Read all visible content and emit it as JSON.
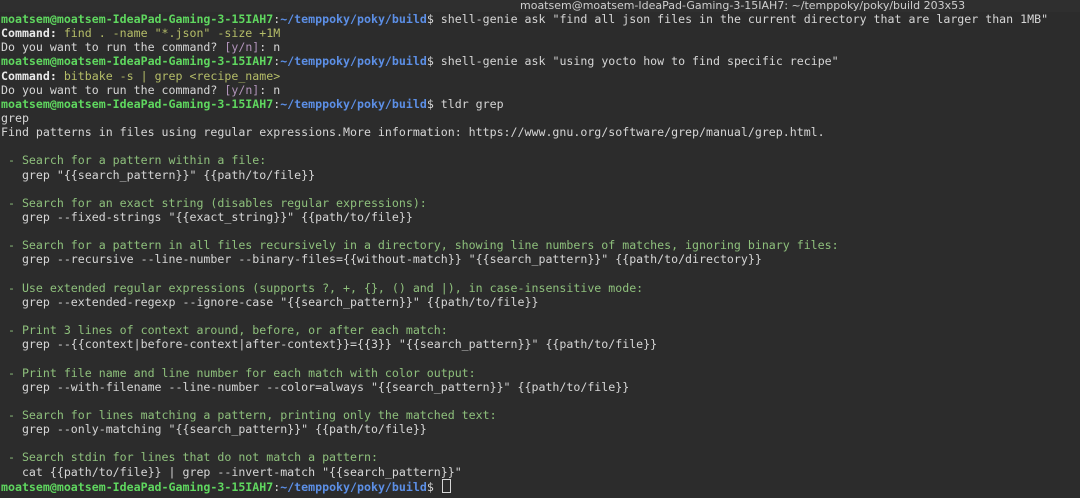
{
  "window": {
    "title": "moatsem@moatsem-IdeaPad-Gaming-3-15IAH7: ~/temppoky/poky/build 203x53"
  },
  "prompt": {
    "user_host": "moatsem@moatsem-IdeaPad-Gaming-3-15IAH7",
    "sep": ":",
    "path": "~/temppoky/poky/build",
    "sign": "$ "
  },
  "session": [
    {
      "kind": "prompt",
      "command": "shell-genie ask \"find all json files in the current directory that are larger than 1MB\""
    },
    {
      "kind": "genie",
      "label": "Command:",
      "command": " find . -name \"*.json\" -size +1M"
    },
    {
      "kind": "confirm",
      "text": "Do you want to run the command? ",
      "options": "[y/n]",
      "answer": ": n"
    },
    {
      "kind": "prompt",
      "command": "shell-genie ask \"using yocto how to find specific recipe\""
    },
    {
      "kind": "genie",
      "label": "Command:",
      "command": " bitbake -s | grep <recipe_name>"
    },
    {
      "kind": "confirm",
      "text": "Do you want to run the command? ",
      "options": "[y/n]",
      "answer": ": n"
    },
    {
      "kind": "prompt",
      "command": "tldr grep"
    },
    {
      "kind": "text",
      "text": "grep"
    },
    {
      "kind": "text",
      "text": "Find patterns in files using regular expressions.More information: https://www.gnu.org/software/grep/manual/grep.html."
    },
    {
      "kind": "blank"
    },
    {
      "kind": "desc",
      "text": " - Search for a pattern within a file:"
    },
    {
      "kind": "example",
      "text": "   grep \"{{search_pattern}}\" {{path/to/file}}"
    },
    {
      "kind": "blank"
    },
    {
      "kind": "desc",
      "text": " - Search for an exact string (disables regular expressions):"
    },
    {
      "kind": "example",
      "text": "   grep --fixed-strings \"{{exact_string}}\" {{path/to/file}}"
    },
    {
      "kind": "blank"
    },
    {
      "kind": "desc",
      "text": " - Search for a pattern in all files recursively in a directory, showing line numbers of matches, ignoring binary files:"
    },
    {
      "kind": "example",
      "text": "   grep --recursive --line-number --binary-files={{without-match}} \"{{search_pattern}}\" {{path/to/directory}}"
    },
    {
      "kind": "blank"
    },
    {
      "kind": "desc",
      "text": " - Use extended regular expressions (supports ?, +, {}, () and |), in case-insensitive mode:"
    },
    {
      "kind": "example",
      "text": "   grep --extended-regexp --ignore-case \"{{search_pattern}}\" {{path/to/file}}"
    },
    {
      "kind": "blank"
    },
    {
      "kind": "desc",
      "text": " - Print 3 lines of context around, before, or after each match:"
    },
    {
      "kind": "example",
      "text": "   grep --{{context|before-context|after-context}}={{3}} \"{{search_pattern}}\" {{path/to/file}}"
    },
    {
      "kind": "blank"
    },
    {
      "kind": "desc",
      "text": " - Print file name and line number for each match with color output:"
    },
    {
      "kind": "example",
      "text": "   grep --with-filename --line-number --color=always \"{{search_pattern}}\" {{path/to/file}}"
    },
    {
      "kind": "blank"
    },
    {
      "kind": "desc",
      "text": " - Search for lines matching a pattern, printing only the matched text:"
    },
    {
      "kind": "example",
      "text": "   grep --only-matching \"{{search_pattern}}\" {{path/to/file}}"
    },
    {
      "kind": "blank"
    },
    {
      "kind": "desc",
      "text": " - Search stdin for lines that do not match a pattern:"
    },
    {
      "kind": "example",
      "text": "   cat {{path/to/file}} | grep --invert-match \"{{search_pattern}}\""
    },
    {
      "kind": "prompt_cursor"
    }
  ],
  "colors": {
    "background": "#2c2c2c",
    "user_host": "#5fd75f",
    "path": "#5c8fe6",
    "genie_command": "#b5bd68",
    "tldr_desc": "#8ec07c",
    "yn": "#b294bb"
  }
}
